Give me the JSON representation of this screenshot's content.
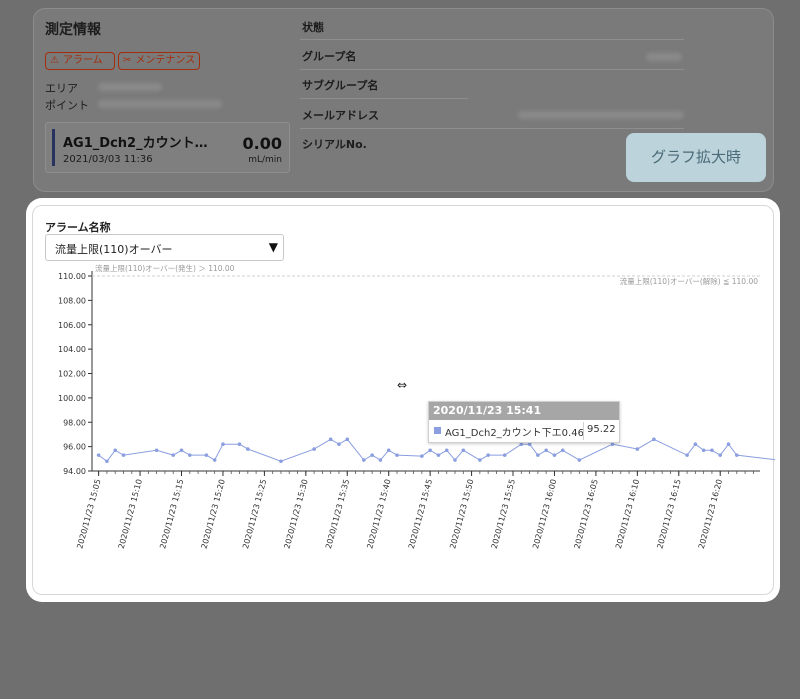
{
  "info": {
    "title": "測定情報",
    "badges": {
      "alarm": "アラーム",
      "maintenance": "メンテナンス"
    },
    "area_label": "エリア",
    "point_label": "ポイント",
    "meter": {
      "name": "AG1_Dch2_カウント…",
      "datetime": "2021/03/03 11:36",
      "value": "0.00",
      "unit": "mL/min"
    },
    "right_labels": {
      "status": "状態",
      "group": "グループ名",
      "subgroup": "サブグループ名",
      "email": "メールアドレス",
      "serial": "シリアルNo."
    }
  },
  "zoom_button": "グラフ拡大時",
  "alarm": {
    "label": "アラーム名称",
    "selected": "流量上限(110)オーバー"
  },
  "tooltip": {
    "time": "2020/11/23 15:41",
    "series": "AG1_Dch2_カウント下エ0.46",
    "value": "95.22"
  },
  "colors": {
    "series": "#8a9ee0",
    "overlay": "#6f6f6f",
    "zoom_button_bg": "#bcd3db"
  },
  "chart_data": {
    "type": "line",
    "thresholds": [
      {
        "label": "流量上限(110)オーバー(発生) ＞ 110.00",
        "value": 110.0
      },
      {
        "label": "流量上限(110)オーバー(解除) ≦ 110.00",
        "value": 110.0
      }
    ],
    "ylim": [
      94.0,
      110.0
    ],
    "yticks": [
      "94.00",
      "96.00",
      "98.00",
      "100.00",
      "102.00",
      "104.00",
      "106.00",
      "108.00",
      "110.00"
    ],
    "xticks": [
      "2020/11/23 15:05",
      "2020/11/23 15:10",
      "2020/11/23 15:15",
      "2020/11/23 15:20",
      "2020/11/23 15:25",
      "2020/11/23 15:30",
      "2020/11/23 15:35",
      "2020/11/23 15:40",
      "2020/11/23 15:45",
      "2020/11/23 15:50",
      "2020/11/23 15:55",
      "2020/11/23 16:00",
      "2020/11/23 16:05",
      "2020/11/23 16:10",
      "2020/11/23 16:15",
      "2020/11/23 16:20"
    ],
    "x_minutes_range": [
      "2020/11/23 15:05",
      "2020/11/23 16:24"
    ],
    "series": [
      {
        "name": "AG1_Dch2_カウント下エ0.46",
        "points": [
          [
            "15:05",
            95.3
          ],
          [
            "15:06",
            94.8
          ],
          [
            "15:07",
            95.7
          ],
          [
            "15:08",
            95.3
          ],
          [
            "15:12",
            95.7
          ],
          [
            "15:14",
            95.3
          ],
          [
            "15:15",
            95.7
          ],
          [
            "15:16",
            95.3
          ],
          [
            "15:18",
            95.3
          ],
          [
            "15:19",
            94.9
          ],
          [
            "15:20",
            96.2
          ],
          [
            "15:22",
            96.2
          ],
          [
            "15:23",
            95.8
          ],
          [
            "15:27",
            94.8
          ],
          [
            "15:31",
            95.8
          ],
          [
            "15:33",
            96.6
          ],
          [
            "15:34",
            96.2
          ],
          [
            "15:35",
            96.6
          ],
          [
            "15:37",
            94.9
          ],
          [
            "15:38",
            95.3
          ],
          [
            "15:39",
            94.9
          ],
          [
            "15:40",
            95.7
          ],
          [
            "15:41",
            95.3
          ],
          [
            "15:44",
            95.22
          ],
          [
            "15:45",
            95.7
          ],
          [
            "15:46",
            95.3
          ],
          [
            "15:47",
            95.7
          ],
          [
            "15:48",
            94.9
          ],
          [
            "15:49",
            95.7
          ],
          [
            "15:51",
            94.9
          ],
          [
            "15:52",
            95.3
          ],
          [
            "15:54",
            95.3
          ],
          [
            "15:56",
            96.2
          ],
          [
            "15:57",
            96.2
          ],
          [
            "15:58",
            95.3
          ],
          [
            "15:59",
            95.7
          ],
          [
            "16:00",
            95.3
          ],
          [
            "16:01",
            95.7
          ],
          [
            "16:03",
            94.9
          ],
          [
            "16:07",
            96.2
          ],
          [
            "16:10",
            95.8
          ],
          [
            "16:12",
            96.6
          ],
          [
            "16:16",
            95.3
          ],
          [
            "16:17",
            96.2
          ],
          [
            "16:18",
            95.7
          ],
          [
            "16:19",
            95.7
          ],
          [
            "16:20",
            95.3
          ],
          [
            "16:21",
            96.2
          ],
          [
            "16:22",
            95.3
          ],
          [
            "16:27",
            94.9
          ]
        ]
      }
    ]
  }
}
